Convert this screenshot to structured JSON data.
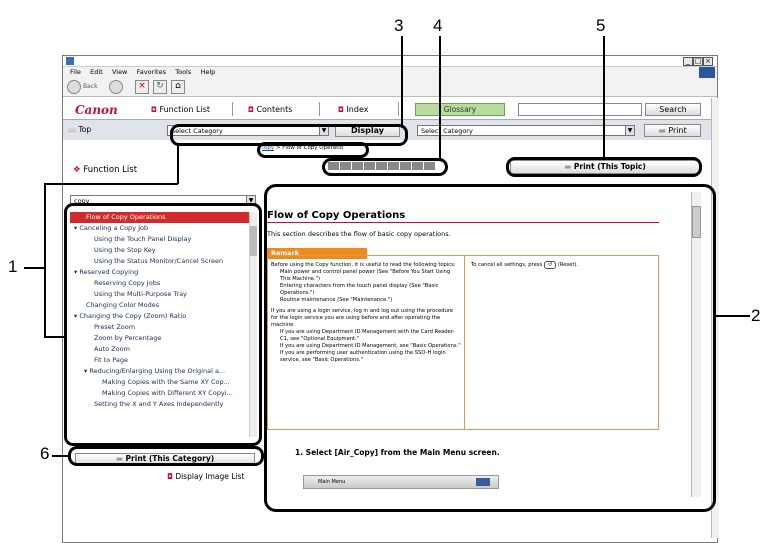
{
  "callouts": [
    "1",
    "2",
    "3",
    "4",
    "5",
    "6"
  ],
  "window": {
    "menu": [
      "File",
      "Edit",
      "View",
      "Favorites",
      "Tools",
      "Help"
    ],
    "nav_back": "Back"
  },
  "toolbar": {
    "logo": "Canon",
    "function_list": "Function List",
    "contents": "Contents",
    "index": "Index",
    "glossary": "Glossary",
    "search": "Search",
    "top": "Top",
    "select_category_left": "Select Category",
    "display": "Display",
    "select_category_right": "Select Category",
    "print": "Print"
  },
  "breadcrumb": {
    "link": "copy",
    "current": "> Flow of Copy Operatio"
  },
  "print_topic": "Print (This Topic)",
  "left": {
    "title": "Function List",
    "filter_value": "copy",
    "items": [
      {
        "label": "Flow of Copy Operations"
      },
      {
        "label": "Canceling a Copy Job"
      },
      {
        "label": "Using the Touch Panel Display"
      },
      {
        "label": "Using the Stop Key"
      },
      {
        "label": "Using the Status Monitor/Cancel Screen"
      },
      {
        "label": "Reserved Copying"
      },
      {
        "label": "Reserving Copy Jobs"
      },
      {
        "label": "Using the Multi-Purpose Tray"
      },
      {
        "label": "Changing Color Modes"
      },
      {
        "label": "Changing the Copy (Zoom) Ratio"
      },
      {
        "label": "Preset Zoom"
      },
      {
        "label": "Zoom by Percentage"
      },
      {
        "label": "Auto Zoom"
      },
      {
        "label": "Fit to Page"
      },
      {
        "label": "Reducing/Enlarging Using the Original a..."
      },
      {
        "label": "Making Copies with the Same XY Cop..."
      },
      {
        "label": "Making Copies with Different XY Copyi..."
      },
      {
        "label": "Setting the X and Y Axes Independently"
      }
    ],
    "print_category": "Print (This Category)",
    "display_image_list": "Display Image List"
  },
  "content": {
    "heading": "Flow of Copy Operations",
    "intro": "This section describes the flow of basic copy operations.",
    "remark": "Remark",
    "remark_col1_p1": "Before using the Copy function, it is useful to read the following topics:",
    "b1": "Main power and control panel power (See \"Before You Start Using This Machine.\")",
    "b2": "Entering characters from the touch panel display (See \"Basic Operations.\")",
    "b3": "Routine maintenance (See \"Maintenance.\")",
    "remark_col1_p2": "If you are using a login service, log in and log out using the procedure for the login service you are using before and after operating the machine.",
    "b4": "If you are using Department ID Management with the Card Reader-C1, see \"Optional Equipment.\"",
    "b5": "If you are using Department ID Management, see \"Basic Operations.\"",
    "b6": "If you are performing user authentication using the SSO-H login service, see \"Basic Operations.\"",
    "remark_col2": "To cancel all settings, press",
    "remark_col2_end": "(Reset).",
    "step1": "1.   Select [Air_Copy] from the Main Menu screen.",
    "mainmenu": "Main Menu"
  }
}
